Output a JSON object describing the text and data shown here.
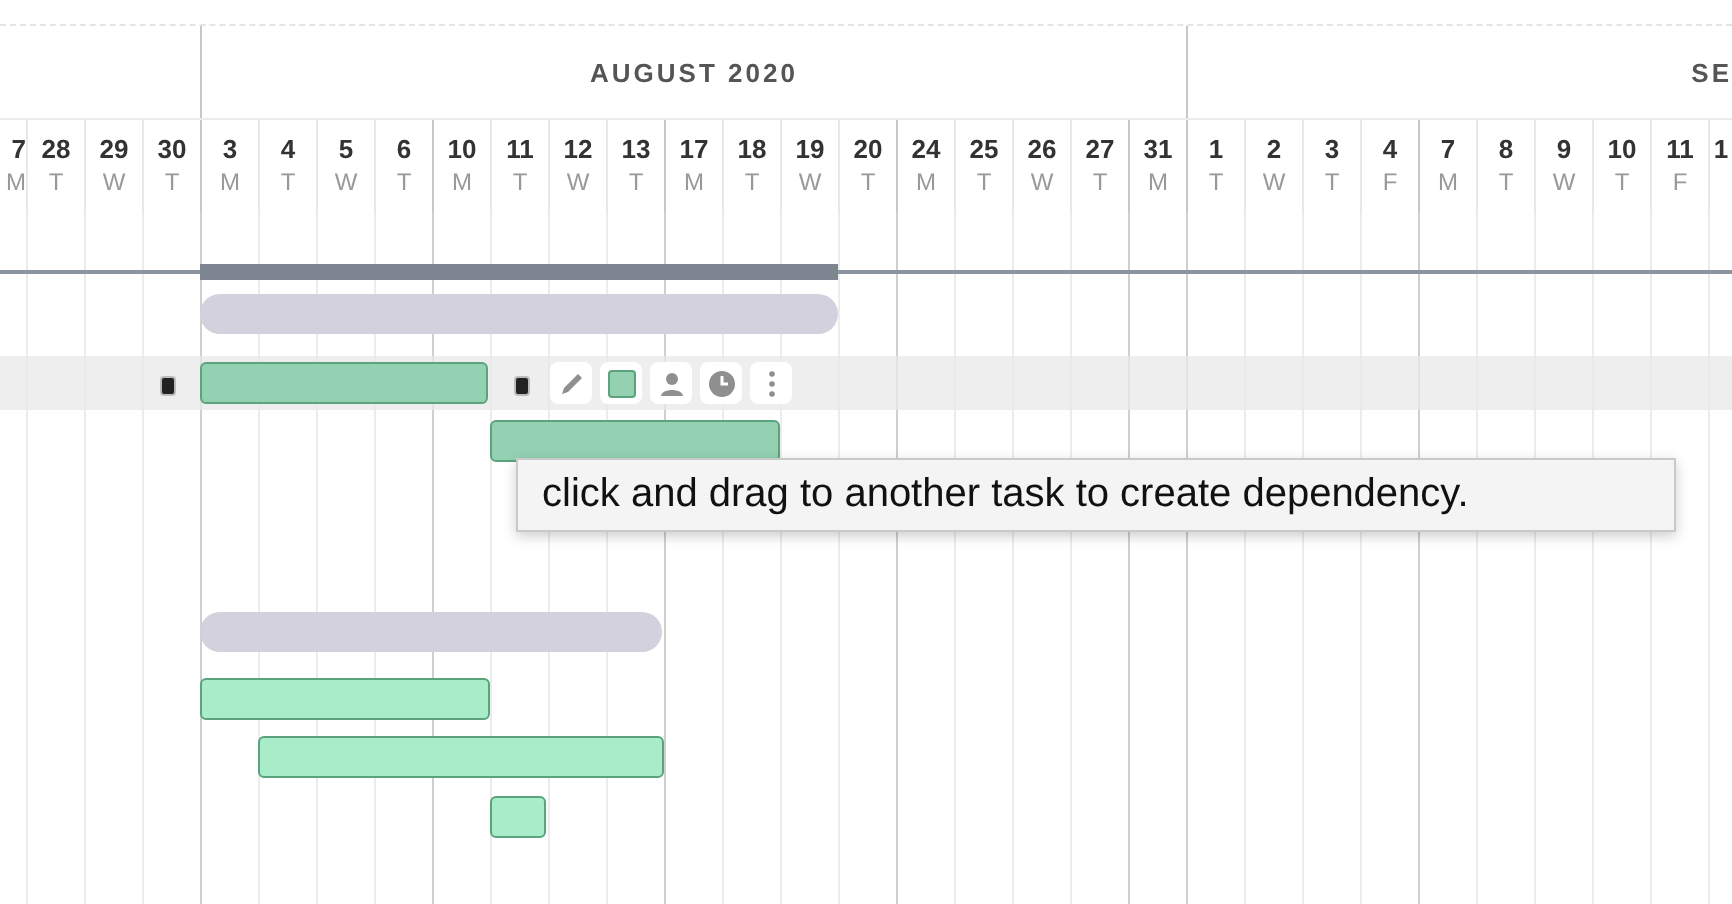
{
  "months": [
    {
      "label": "AUGUST 2020"
    },
    {
      "label": "SE"
    }
  ],
  "days": [
    {
      "day": "7",
      "weekday": "M"
    },
    {
      "day": "28",
      "weekday": "T"
    },
    {
      "day": "29",
      "weekday": "W"
    },
    {
      "day": "30",
      "weekday": "T"
    },
    {
      "day": "3",
      "weekday": "M"
    },
    {
      "day": "4",
      "weekday": "T"
    },
    {
      "day": "5",
      "weekday": "W"
    },
    {
      "day": "6",
      "weekday": "T"
    },
    {
      "day": "10",
      "weekday": "M"
    },
    {
      "day": "11",
      "weekday": "T"
    },
    {
      "day": "12",
      "weekday": "W"
    },
    {
      "day": "13",
      "weekday": "T"
    },
    {
      "day": "17",
      "weekday": "M"
    },
    {
      "day": "18",
      "weekday": "T"
    },
    {
      "day": "19",
      "weekday": "W"
    },
    {
      "day": "20",
      "weekday": "T"
    },
    {
      "day": "24",
      "weekday": "M"
    },
    {
      "day": "25",
      "weekday": "T"
    },
    {
      "day": "26",
      "weekday": "W"
    },
    {
      "day": "27",
      "weekday": "T"
    },
    {
      "day": "31",
      "weekday": "M"
    },
    {
      "day": "1",
      "weekday": "T"
    },
    {
      "day": "2",
      "weekday": "W"
    },
    {
      "day": "3",
      "weekday": "T"
    },
    {
      "day": "4",
      "weekday": "F"
    },
    {
      "day": "7",
      "weekday": "M"
    },
    {
      "day": "8",
      "weekday": "T"
    },
    {
      "day": "9",
      "weekday": "W"
    },
    {
      "day": "10",
      "weekday": "T"
    },
    {
      "day": "11",
      "weekday": "F"
    },
    {
      "day": "1"
    }
  ],
  "rows": [
    {
      "kind": "milestone-line",
      "selected": false
    },
    {
      "kind": "summary",
      "selected": false
    },
    {
      "kind": "task",
      "selected": true,
      "color": "#93d1b2"
    },
    {
      "kind": "task",
      "selected": false,
      "color": "#93d1b2"
    },
    {
      "kind": "summary",
      "selected": false
    },
    {
      "kind": "task",
      "selected": false,
      "color": "#a8ecca"
    },
    {
      "kind": "task",
      "selected": false,
      "color": "#a8ecca"
    },
    {
      "kind": "task",
      "selected": false,
      "color": "#a8ecca"
    }
  ],
  "tooltip": "click and drag to another task to create dependency."
}
